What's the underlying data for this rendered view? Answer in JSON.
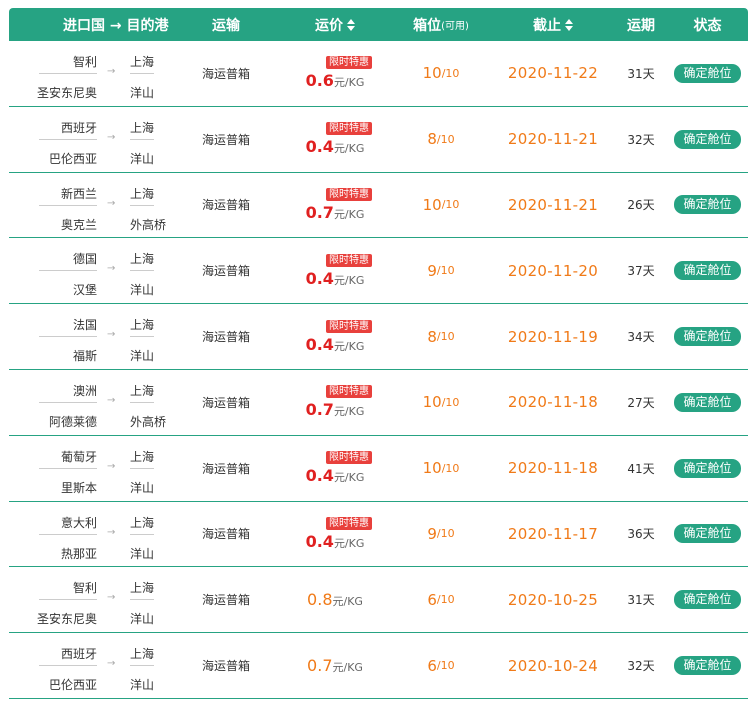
{
  "header": {
    "route": "进口国 → 目的港",
    "transport": "运输",
    "price": "运价",
    "slots": "箱位",
    "slots_sub": "(可用)",
    "cutoff": "截止",
    "days": "运期",
    "status": "状态"
  },
  "colors": {
    "accent": "#26a383",
    "orange": "#f07a18",
    "red": "#e02020"
  },
  "rows": [
    {
      "o1": "智利",
      "o2": "圣安东尼奥",
      "d1": "上海",
      "d2": "洋山",
      "transport": "海运普箱",
      "badge": "限时特惠",
      "price": "0.6",
      "unit": "元/KG",
      "used": "10",
      "total": "/10",
      "cutoff": "2020-11-22",
      "days": "31天",
      "action": "确定舱位"
    },
    {
      "o1": "西班牙",
      "o2": "巴伦西亚",
      "d1": "上海",
      "d2": "洋山",
      "transport": "海运普箱",
      "badge": "限时特惠",
      "price": "0.4",
      "unit": "元/KG",
      "used": "8",
      "total": "/10",
      "cutoff": "2020-11-21",
      "days": "32天",
      "action": "确定舱位"
    },
    {
      "o1": "新西兰",
      "o2": "奥克兰",
      "d1": "上海",
      "d2": "外高桥",
      "transport": "海运普箱",
      "badge": "限时特惠",
      "price": "0.7",
      "unit": "元/KG",
      "used": "10",
      "total": "/10",
      "cutoff": "2020-11-21",
      "days": "26天",
      "action": "确定舱位"
    },
    {
      "o1": "德国",
      "o2": "汉堡",
      "d1": "上海",
      "d2": "洋山",
      "transport": "海运普箱",
      "badge": "限时特惠",
      "price": "0.4",
      "unit": "元/KG",
      "used": "9",
      "total": "/10",
      "cutoff": "2020-11-20",
      "days": "37天",
      "action": "确定舱位"
    },
    {
      "o1": "法国",
      "o2": "福斯",
      "d1": "上海",
      "d2": "洋山",
      "transport": "海运普箱",
      "badge": "限时特惠",
      "price": "0.4",
      "unit": "元/KG",
      "used": "8",
      "total": "/10",
      "cutoff": "2020-11-19",
      "days": "34天",
      "action": "确定舱位"
    },
    {
      "o1": "澳洲",
      "o2": "阿德莱德",
      "d1": "上海",
      "d2": "外高桥",
      "transport": "海运普箱",
      "badge": "限时特惠",
      "price": "0.7",
      "unit": "元/KG",
      "used": "10",
      "total": "/10",
      "cutoff": "2020-11-18",
      "days": "27天",
      "action": "确定舱位"
    },
    {
      "o1": "葡萄牙",
      "o2": "里斯本",
      "d1": "上海",
      "d2": "洋山",
      "transport": "海运普箱",
      "badge": "限时特惠",
      "price": "0.4",
      "unit": "元/KG",
      "used": "10",
      "total": "/10",
      "cutoff": "2020-11-18",
      "days": "41天",
      "action": "确定舱位"
    },
    {
      "o1": "意大利",
      "o2": "热那亚",
      "d1": "上海",
      "d2": "洋山",
      "transport": "海运普箱",
      "badge": "限时特惠",
      "price": "0.4",
      "unit": "元/KG",
      "used": "9",
      "total": "/10",
      "cutoff": "2020-11-17",
      "days": "36天",
      "action": "确定舱位"
    },
    {
      "o1": "智利",
      "o2": "圣安东尼奥",
      "d1": "上海",
      "d2": "洋山",
      "transport": "海运普箱",
      "badge": "",
      "price": "0.8",
      "unit": "元/KG",
      "used": "6",
      "total": "/10",
      "cutoff": "2020-10-25",
      "days": "31天",
      "action": "确定舱位"
    },
    {
      "o1": "西班牙",
      "o2": "巴伦西亚",
      "d1": "上海",
      "d2": "洋山",
      "transport": "海运普箱",
      "badge": "",
      "price": "0.7",
      "unit": "元/KG",
      "used": "6",
      "total": "/10",
      "cutoff": "2020-10-24",
      "days": "32天",
      "action": "确定舱位"
    }
  ]
}
